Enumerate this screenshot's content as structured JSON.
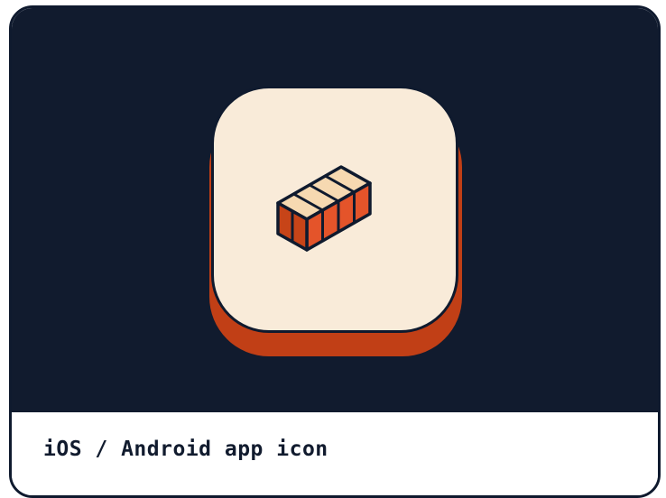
{
  "caption": {
    "text": "iOS / Android app icon"
  },
  "colors": {
    "background_dark": "#111b2e",
    "icon_face": "#f9ebd9",
    "icon_shadow": "#c13f16",
    "brick_top": "#f6d9b1",
    "brick_side": "#e4542a",
    "brick_front": "#c74418",
    "outline": "#0f1a2e"
  },
  "icon": {
    "name": "brick-icon"
  }
}
